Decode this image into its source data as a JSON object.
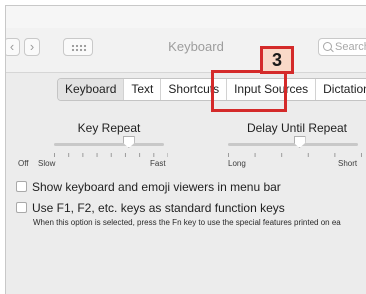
{
  "window": {
    "title": "Keyboard",
    "nav_back_icon": "chevron-left",
    "nav_forward_icon": "chevron-right",
    "grid_icon": "grid-dots",
    "search_placeholder": "Search"
  },
  "tabs": [
    {
      "label": "Keyboard",
      "active": true
    },
    {
      "label": "Text",
      "active": false
    },
    {
      "label": "Shortcuts",
      "active": false
    },
    {
      "label": "Input Sources",
      "active": false
    },
    {
      "label": "Dictation",
      "active": false
    }
  ],
  "callout": {
    "number": "3",
    "color": "#d42a2a",
    "fill": "#f9d9c8"
  },
  "key_repeat": {
    "label": "Key Repeat",
    "min_label": "Off",
    "low_label": "Slow",
    "high_label": "Fast",
    "level": 0.68
  },
  "delay_until_repeat": {
    "label": "Delay Until Repeat",
    "low_label": "Long",
    "high_label": "Short",
    "level": 0.55
  },
  "options": {
    "show_viewers": "Show keyboard and emoji viewers in menu bar",
    "fn_keys": "Use F1, F2, etc. keys as standard function keys",
    "fn_note": "When this option is selected, press the Fn key to use the special features printed on ea"
  }
}
